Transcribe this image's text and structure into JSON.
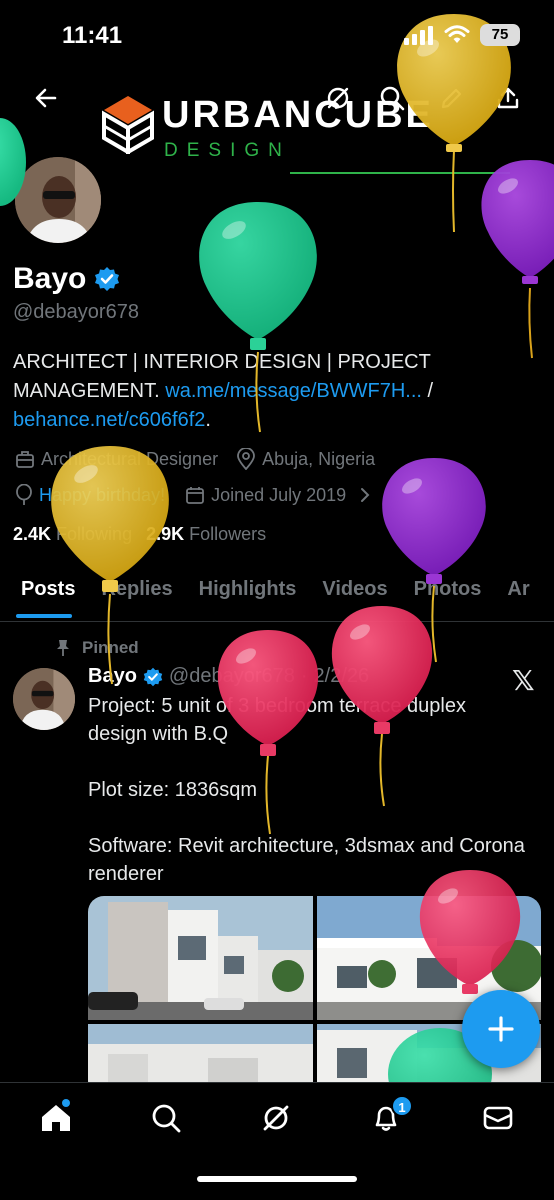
{
  "status_bar": {
    "time": "11:41",
    "battery": "75"
  },
  "banner": {
    "brand_title": "URBANCUBE",
    "brand_sub": "DESIGN"
  },
  "profile": {
    "name": "Bayo",
    "handle": "@debayor678",
    "bio_text": "ARCHITECT | INTERIOR DESIGN | PROJECT MANAGEMENT.",
    "bio_link_1": "wa.me/message/BWWF7H...",
    "bio_separator": "/",
    "bio_link_2": "behance.net/c606f6f2",
    "bio_end": ".",
    "category": "Architectural Designer",
    "location": "Abuja, Nigeria",
    "birthday": "Happy birthday!",
    "joined": "Joined July 2019",
    "following_count": "2.4K",
    "following_label": "Following",
    "followers_count": "2.9K",
    "followers_label": "Followers"
  },
  "tabs": [
    "Posts",
    "Replies",
    "Highlights",
    "Videos",
    "Photos",
    "Ar"
  ],
  "post": {
    "pinned_label": "Pinned",
    "author": "Bayo",
    "handle": "@debayor678",
    "dot": "·",
    "date": "2/2/26",
    "text": "Project: 5 unit of 3 bedroom terrace duplex design with B.Q\n\nPlot size: 1836sqm\n\nSoftware: Revit architecture, 3dsmax and Corona renderer",
    "platform_logo": "𝕏"
  },
  "bottom_nav": {
    "notification_count": "1"
  },
  "icons": [
    "back-arrow-icon",
    "grok-icon",
    "search-icon",
    "edit-pen-icon",
    "share-icon",
    "verified-icon",
    "briefcase-icon",
    "location-pin-icon",
    "balloon-icon",
    "calendar-icon",
    "chevron-right-icon",
    "pin-icon",
    "plus-icon",
    "home-icon",
    "bell-icon",
    "mail-icon"
  ],
  "colors": {
    "accent": "#1d9bf0",
    "brand_green": "#2fb34a",
    "brand_orange": "#e8601e",
    "muted": "#71767b",
    "background": "#000000"
  }
}
